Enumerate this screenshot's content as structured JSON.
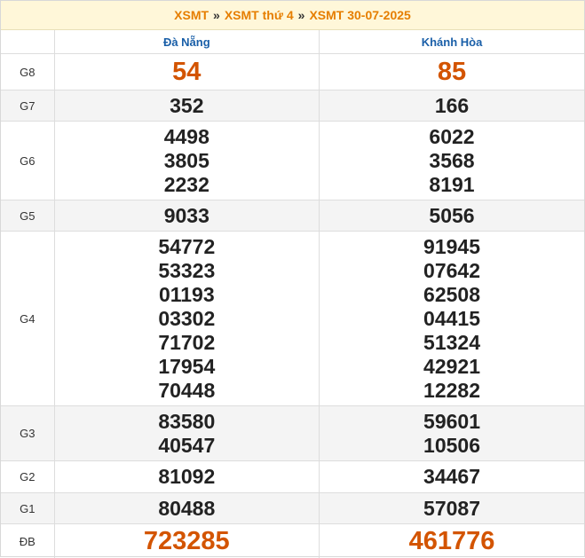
{
  "breadcrumb": {
    "item1": "XSMT",
    "item2": "XSMT thứ 4",
    "item3": "XSMT 30-07-2025",
    "separator": "»"
  },
  "table": {
    "provinces": [
      "Đà Nẵng",
      "Khánh Hòa"
    ],
    "rows": [
      {
        "label": "G8",
        "values": [
          [
            "54"
          ],
          [
            "85"
          ]
        ]
      },
      {
        "label": "G7",
        "values": [
          [
            "352"
          ],
          [
            "166"
          ]
        ]
      },
      {
        "label": "G6",
        "values": [
          [
            "4498",
            "3805",
            "2232"
          ],
          [
            "6022",
            "3568",
            "8191"
          ]
        ]
      },
      {
        "label": "G5",
        "values": [
          [
            "9033"
          ],
          [
            "5056"
          ]
        ]
      },
      {
        "label": "G4",
        "values": [
          [
            "54772",
            "53323",
            "01193",
            "03302",
            "71702",
            "17954",
            "70448"
          ],
          [
            "91945",
            "07642",
            "62508",
            "04415",
            "51324",
            "42921",
            "12282"
          ]
        ]
      },
      {
        "label": "G3",
        "values": [
          [
            "83580",
            "40547"
          ],
          [
            "59601",
            "10506"
          ]
        ]
      },
      {
        "label": "G2",
        "values": [
          [
            "81092"
          ],
          [
            "34467"
          ]
        ]
      },
      {
        "label": "G1",
        "values": [
          [
            "80488"
          ],
          [
            "57087"
          ]
        ]
      },
      {
        "label": "ĐB",
        "values": [
          [
            "723285"
          ],
          [
            "461776"
          ]
        ]
      }
    ]
  },
  "colors": {
    "accent": "#e67e00",
    "highlight_number": "#d35400",
    "province_header": "#1a5fa8",
    "breadcrumb_bg": "#fff7d9"
  }
}
